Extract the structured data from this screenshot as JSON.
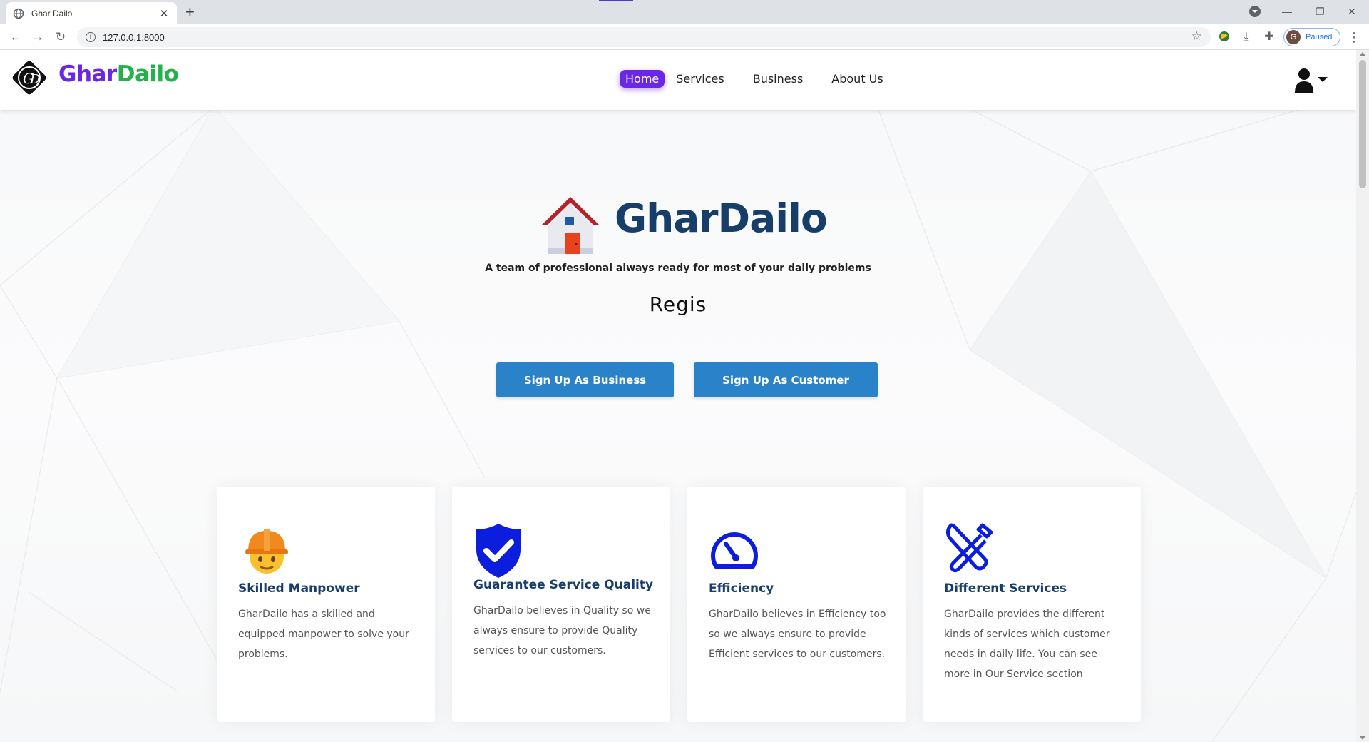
{
  "browser": {
    "tab_title": "Ghar Dailo",
    "url": "127.0.0.1:8000",
    "profile_initial": "G",
    "profile_status": "Paused"
  },
  "navbar": {
    "brand_part1": "Ghar",
    "brand_part2": "Dailo",
    "links": [
      "Home",
      "Services",
      "Business",
      "About Us"
    ],
    "active_link": "Home",
    "colors": {
      "brand_purple": "#6a27e6",
      "brand_green": "#21b24b"
    }
  },
  "hero": {
    "title": "GharDailo",
    "tagline": "A team of professional always ready for most of your daily problems",
    "typed_text": "Regis",
    "buttons": {
      "business": "Sign Up As Business",
      "customer": "Sign Up As Customer"
    },
    "colors": {
      "title": "#163e68",
      "button": "#2a83c9"
    }
  },
  "features": [
    {
      "icon": "worker-helmet-icon",
      "title": "Skilled Manpower",
      "text": "GharDailo has a skilled and equipped manpower to solve your problems."
    },
    {
      "icon": "shield-check-icon",
      "title": "Guarantee Service Quality",
      "text": "GharDailo believes in Quality so we always ensure to provide Quality services to our customers."
    },
    {
      "icon": "speedometer-icon",
      "title": "Efficiency",
      "text": "GharDailo believes in Efficiency too so we always ensure to provide Efficient services to our customers."
    },
    {
      "icon": "tools-icon",
      "title": "Different Services",
      "text": "GharDailo provides the different kinds of services which customer needs in daily life. You can see more in Our Service section"
    }
  ]
}
